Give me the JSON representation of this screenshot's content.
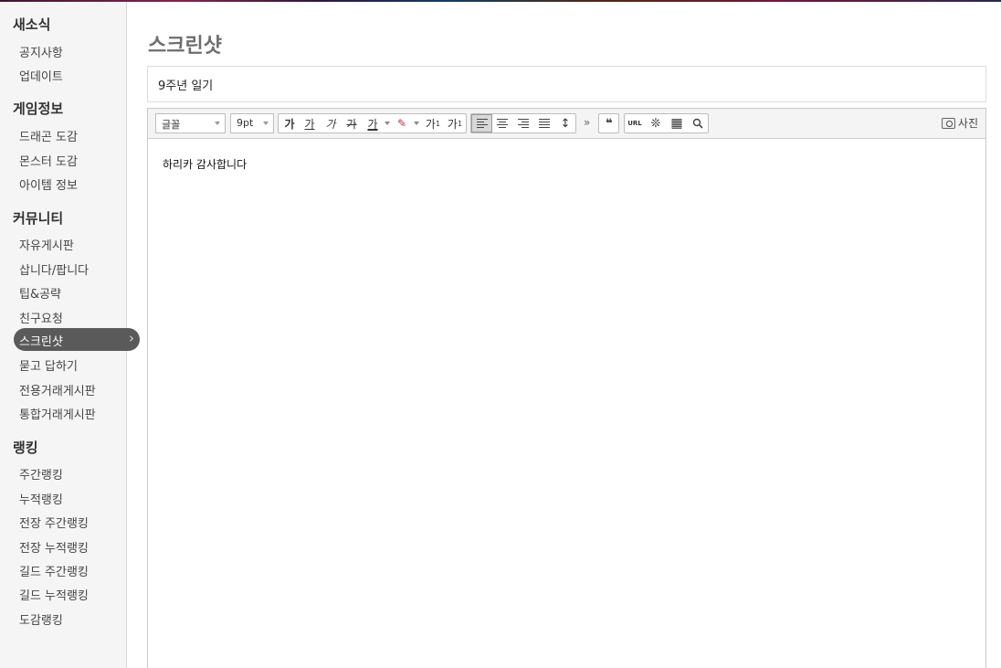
{
  "page": {
    "title": "스크린샷"
  },
  "sidebar": {
    "sections": [
      {
        "title": "새소식",
        "items": [
          "공지사항",
          "업데이트"
        ]
      },
      {
        "title": "게임정보",
        "items": [
          "드래곤 도감",
          "몬스터 도감",
          "아이템 정보"
        ]
      },
      {
        "title": "커뮤니티",
        "items": [
          "자유게시판",
          "삽니다/팝니다",
          "팁&공략",
          "친구요청",
          "스크린샷",
          "묻고 답하기",
          "전용거래게시판",
          "통합거래게시판"
        ]
      },
      {
        "title": "랭킹",
        "items": [
          "주간랭킹",
          "누적랭킹",
          "전장 주간랭킹",
          "전장 누적랭킹",
          "길드 주간랭킹",
          "길드 누적랭킹",
          "도감랭킹"
        ]
      }
    ],
    "active_item": "스크린샷"
  },
  "post": {
    "title_value": "9주년 일기",
    "body_text": "하리카 감사합니다"
  },
  "toolbar": {
    "font_select": "글꼴",
    "size_select": "9pt",
    "bold": "가",
    "underline": "가",
    "italic": "가",
    "strike": "가",
    "text_color": "가",
    "superscript": "가",
    "subscript": "가",
    "more": "»",
    "quote": "❝",
    "url": "URL",
    "photo_label": "사진"
  },
  "colors": {
    "active_nav": "#5a5a5a",
    "page_title": "#6e6e6e"
  }
}
